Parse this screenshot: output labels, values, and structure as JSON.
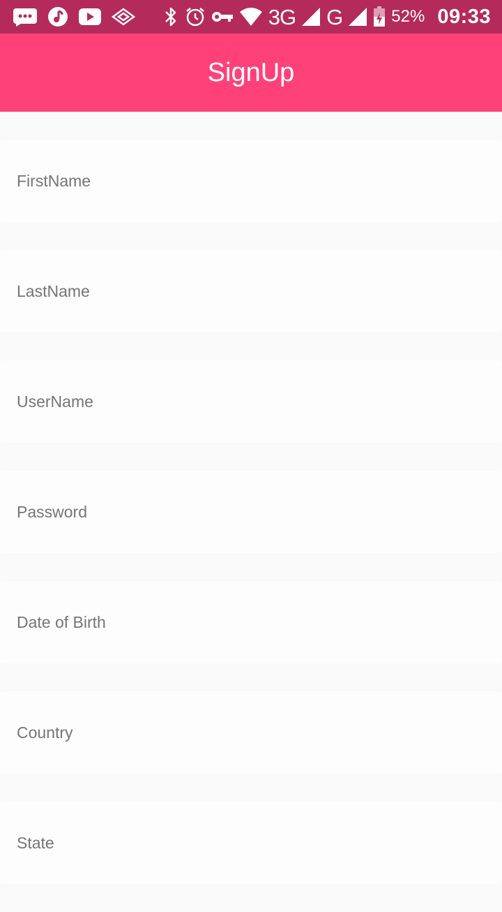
{
  "status_bar": {
    "left_icons": [
      "chat-bubble-icon",
      "music-note-icon",
      "youtube-icon",
      "vpn-diamond-icon"
    ],
    "right_icons": [
      "bluetooth-icon",
      "alarm-icon",
      "key-icon",
      "wifi-icon",
      "cell-signal-icon",
      "battery-icon"
    ],
    "network_3g": "3G",
    "network_g": "G",
    "battery_percent": "52%",
    "time": "09:33",
    "background_color": "#b42a5b"
  },
  "app_bar": {
    "title": "SignUp",
    "background_color": "#ff417a"
  },
  "form": {
    "fields": [
      {
        "placeholder": "FirstName",
        "value": ""
      },
      {
        "placeholder": "LastName",
        "value": ""
      },
      {
        "placeholder": "UserName",
        "value": ""
      },
      {
        "placeholder": "Password",
        "value": ""
      },
      {
        "placeholder": "Date of Birth",
        "value": ""
      },
      {
        "placeholder": "Country",
        "value": ""
      },
      {
        "placeholder": "State",
        "value": ""
      }
    ]
  }
}
